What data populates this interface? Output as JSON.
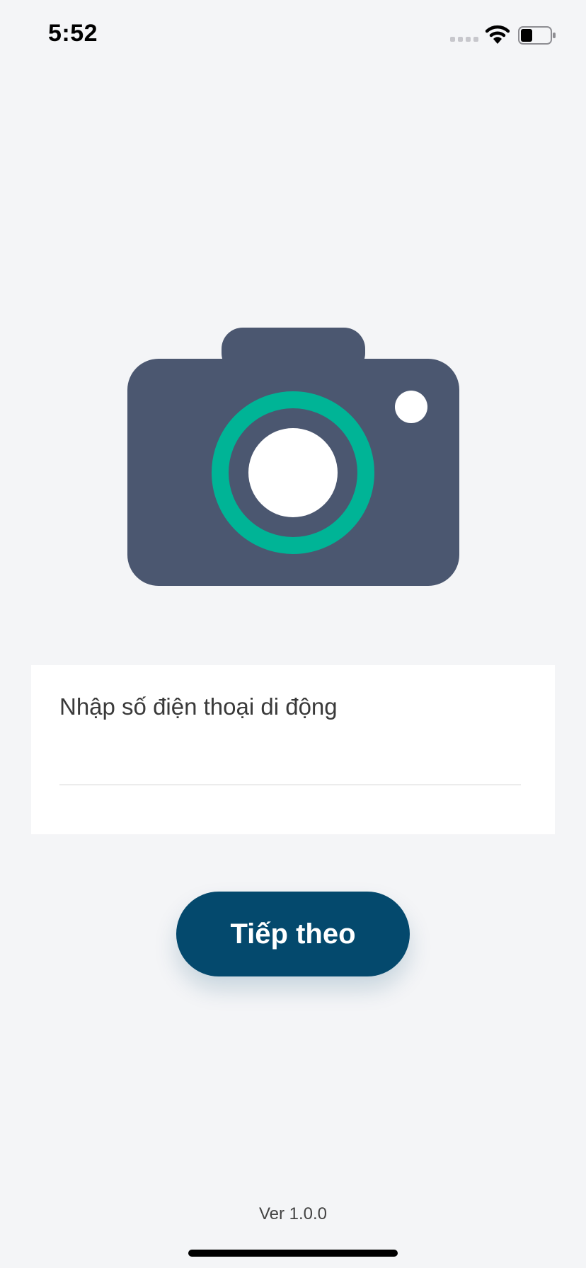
{
  "status_bar": {
    "time": "5:52"
  },
  "camera": {
    "body_color": "#4b5770",
    "lens_ring_color": "#00b496",
    "lens_color": "#ffffff",
    "icon": "camera-icon"
  },
  "phone_form": {
    "label": "Nhập số điện thoại di động",
    "value": "",
    "placeholder": ""
  },
  "next_button": {
    "label": "Tiếp theo",
    "color": "#04496d"
  },
  "footer": {
    "version": "Ver 1.0.0"
  }
}
